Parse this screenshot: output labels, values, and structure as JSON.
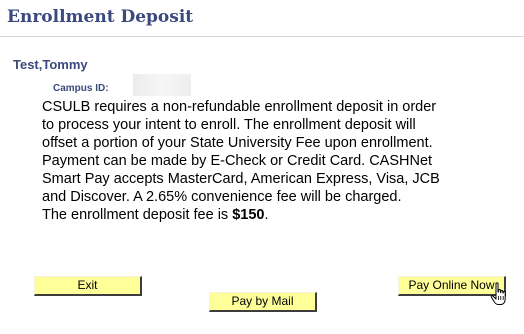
{
  "header": {
    "title": "Enrollment Deposit"
  },
  "student": {
    "name": "Test,Tommy",
    "campus_id_label": "Campus ID:",
    "campus_id_value": ""
  },
  "description": {
    "body": "CSULB requires a non-refundable enrollment deposit in order to process your intent to enroll. The enrollment deposit will offset a portion of your State University Fee upon enrollment. Payment can be made by E-Check or Credit Card. CASHNet Smart Pay accepts MasterCard, American Express, Visa, JCB and Discover. A 2.65% convenience fee will be charged.",
    "fee_prefix": "The enrollment deposit fee is ",
    "fee_amount": "$150",
    "fee_suffix": "."
  },
  "buttons": {
    "exit_label": "Exit",
    "pay_by_mail_label": "Pay by Mail",
    "pay_online_label": "Pay Online Now"
  },
  "icons": {
    "cursor": "hand-pointer-icon"
  },
  "colors": {
    "heading": "#3a4a7e",
    "button_bg": "#ffff99"
  }
}
